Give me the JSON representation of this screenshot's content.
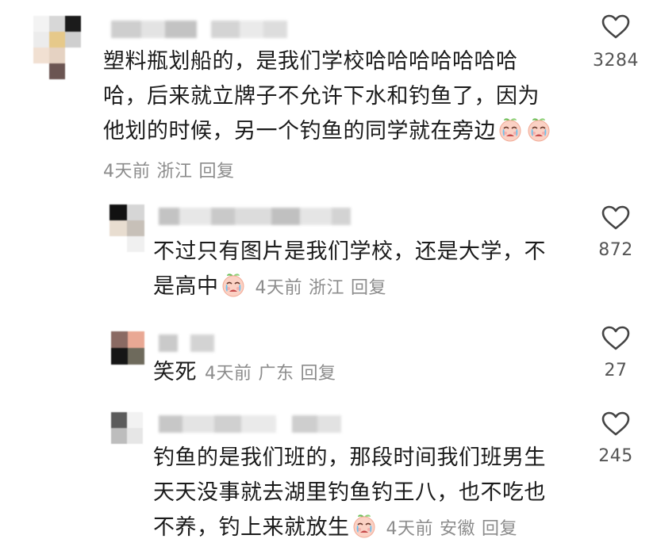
{
  "comments": [
    {
      "lines": [
        "塑料瓶划船的，是我们学校哈哈哈哈哈哈哈",
        "哈，后来就立牌子不允许下水和钓鱼了，因为",
        "他划的时候，另一个钓鱼的同学就在旁边"
      ],
      "time": "4天前",
      "location": "浙江",
      "reply": "回复",
      "likes": "3284",
      "emoji": "crying-peach-emoji"
    },
    {
      "lines": [
        "不过只有图片是我们学校，还是大学，不",
        "是高中"
      ],
      "time": "4天前",
      "location": "浙江",
      "reply": "回复",
      "likes": "872",
      "emoji": "crying-peach-emoji"
    },
    {
      "lines": [
        "笑死"
      ],
      "time": "4天前",
      "location": "广东",
      "reply": "回复",
      "likes": "27"
    },
    {
      "lines": [
        "钓鱼的是我们班的，那段时间我们班男生",
        "天天没事就去湖里钓鱼钓王八，也不吃也",
        "不养，钓上来就放生"
      ],
      "time": "4天前",
      "location": "安徽",
      "reply": "回复",
      "likes": "245",
      "emoji": "crying-peach-emoji"
    }
  ],
  "icons": {
    "like": "heart-outline-icon"
  },
  "colors": {
    "meta": "#8c8c8c",
    "text": "#1b1b1b",
    "heart": "#444444"
  }
}
